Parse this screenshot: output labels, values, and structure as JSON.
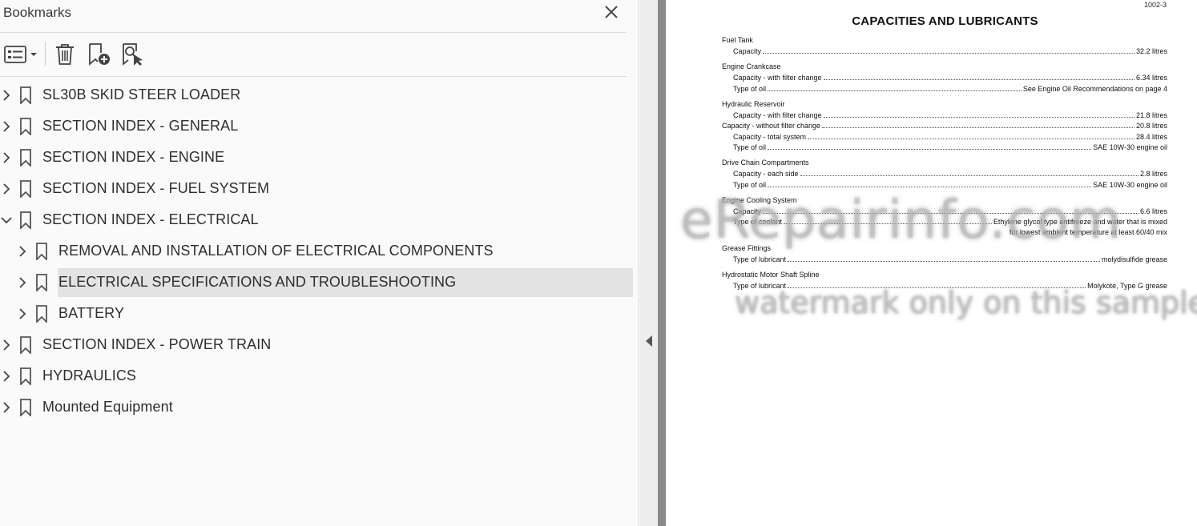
{
  "bookmarks_panel": {
    "title": "Bookmarks",
    "toolbar": {
      "options_icon": "list-options-icon",
      "delete_icon": "trash-icon",
      "add_icon": "add-bookmark-icon",
      "find_icon": "find-bookmark-icon"
    },
    "items": [
      {
        "label": "SL30B SKID STEER LOADER",
        "level": 0,
        "expanded": false,
        "selected": false
      },
      {
        "label": "SECTION INDEX - GENERAL",
        "level": 0,
        "expanded": false,
        "selected": false
      },
      {
        "label": "SECTION INDEX - ENGINE",
        "level": 0,
        "expanded": false,
        "selected": false
      },
      {
        "label": "SECTION INDEX - FUEL SYSTEM",
        "level": 0,
        "expanded": false,
        "selected": false
      },
      {
        "label": "SECTION INDEX - ELECTRICAL",
        "level": 0,
        "expanded": true,
        "selected": false
      },
      {
        "label": "REMOVAL AND INSTALLATION OF ELECTRICAL COMPONENTS",
        "level": 1,
        "expanded": false,
        "selected": false
      },
      {
        "label": "ELECTRICAL SPECIFICATIONS AND TROUBLESHOOTING",
        "level": 1,
        "expanded": false,
        "selected": true
      },
      {
        "label": "BATTERY",
        "level": 1,
        "expanded": false,
        "selected": false
      },
      {
        "label": "SECTION INDEX - POWER TRAIN",
        "level": 0,
        "expanded": false,
        "selected": false
      },
      {
        "label": "HYDRAULICS",
        "level": 0,
        "expanded": false,
        "selected": false
      },
      {
        "label": "Mounted Equipment",
        "level": 0,
        "expanded": false,
        "selected": false
      }
    ]
  },
  "document": {
    "page_number": "1002-3",
    "title": "CAPACITIES AND LUBRICANTS",
    "sections": [
      {
        "heading": "Fuel Tank",
        "lines": [
          {
            "label": "Capacity",
            "value": "32.2 litres",
            "indent": true
          }
        ]
      },
      {
        "heading": "Engine Crankcase",
        "lines": [
          {
            "label": "Capacity - with filter change",
            "value": "6.34 litres",
            "indent": true
          },
          {
            "label": "Type of oil",
            "value": "See Engine Oil Recommendations on page 4",
            "indent": true
          }
        ]
      },
      {
        "heading": "Hydraulic Reservoir",
        "lines": [
          {
            "label": "Capacity - with filter change",
            "value": "21.8 litres",
            "indent": true
          },
          {
            "label": "Capacity - without filter change",
            "value": "20.8 litres",
            "indent": false
          },
          {
            "label": "Capacity - total system",
            "value": "28.4 litres",
            "indent": true
          },
          {
            "label": "Type of oil",
            "value": "SAE 10W-30 engine oil",
            "indent": true
          }
        ]
      },
      {
        "heading": "Drive Chain Compartments",
        "lines": [
          {
            "label": "Capacity - each side",
            "value": "2.8 litres",
            "indent": true
          },
          {
            "label": "Type of oil",
            "value": "SAE 10W-30 engine oil",
            "indent": true
          }
        ]
      },
      {
        "heading": "Engine Cooling System",
        "lines": [
          {
            "label": "Capacity",
            "value": "6.6 litres",
            "indent": true
          },
          {
            "label": "Type of coolant",
            "value": "Ethylene glycol type antifreeze and water that is mixed",
            "indent": true
          }
        ],
        "continuation": "for lowest ambient temperature at least 60/40 mix"
      },
      {
        "heading": "Grease Fittings",
        "lines": [
          {
            "label": "Type of lubricant",
            "value": "molydisulfide grease",
            "indent": true
          }
        ]
      },
      {
        "heading": "Hydrostatic Motor Shaft Spline",
        "lines": [
          {
            "label": "Type of lubricant",
            "value": "Molykote, Type G grease",
            "indent": true
          }
        ]
      }
    ],
    "watermark_primary": "eRepairinfo.com",
    "watermark_secondary": "watermark only on this sample"
  }
}
